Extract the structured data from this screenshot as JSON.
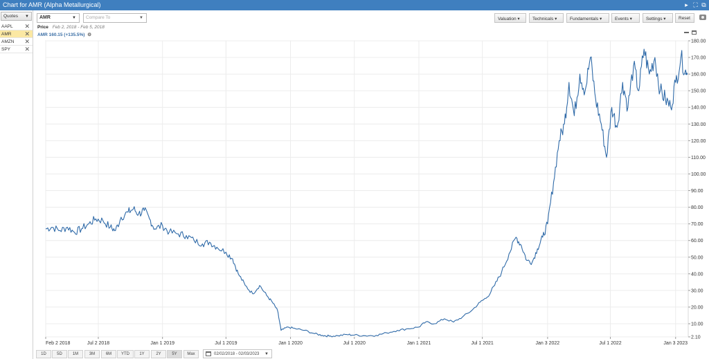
{
  "window": {
    "title": "Chart for AMR (Alpha Metallurgical)",
    "controls": [
      "play-icon",
      "expand-icon",
      "popout-icon"
    ]
  },
  "sidebar": {
    "dropdown_label": "Quotes",
    "quotes": [
      {
        "symbol": "AAPL",
        "selected": false
      },
      {
        "symbol": "AMR",
        "selected": true
      },
      {
        "symbol": "AMZN",
        "selected": false
      },
      {
        "symbol": "SPY",
        "selected": false
      }
    ]
  },
  "toolbar": {
    "symbol_value": "AMR",
    "compare_placeholder": "Compare To",
    "buttons": [
      "Valuation",
      "Technicals",
      "Fundamentals",
      "Events",
      "Settings"
    ],
    "reset_label": "Reset",
    "camera_icon": "camera-icon"
  },
  "header": {
    "price_label": "Price",
    "date_range_text": "Feb 2, 2018 - Feb 5, 2018",
    "series_label": "AMR 160.15 (+135.5%)"
  },
  "chart_data": {
    "type": "line",
    "title": "",
    "xlabel": "",
    "ylabel": "",
    "y_axis_side": "right",
    "ylim": [
      2.1,
      180.0
    ],
    "y_ticks": [
      "2.10",
      "10.00",
      "20.00",
      "30.00",
      "40.00",
      "50.00",
      "60.00",
      "70.00",
      "80.00",
      "90.00",
      "100.00",
      "110.00",
      "120.00",
      "130.00",
      "140.00",
      "150.00",
      "160.00",
      "170.00",
      "180.00"
    ],
    "x_ticks": [
      "Feb 2 2018",
      "Jul 2 2018",
      "Jan 1 2019",
      "Jul 1 2019",
      "Jan 1 2020",
      "Jul 1 2020",
      "Jan 1 2021",
      "Jul 1 2021",
      "Jan 3 2022",
      "Jul 1 2022",
      "Jan 3 2023"
    ],
    "grid": true,
    "line_color": "#2f6aa8",
    "series": [
      {
        "name": "AMR",
        "points": [
          [
            "2018-02-02",
            67
          ],
          [
            "2018-02-20",
            68
          ],
          [
            "2018-03-15",
            66
          ],
          [
            "2018-04-05",
            68
          ],
          [
            "2018-04-25",
            65
          ],
          [
            "2018-05-15",
            67
          ],
          [
            "2018-06-05",
            70
          ],
          [
            "2018-06-25",
            73
          ],
          [
            "2018-07-15",
            72
          ],
          [
            "2018-08-05",
            68
          ],
          [
            "2018-08-20",
            66
          ],
          [
            "2018-09-05",
            74
          ],
          [
            "2018-09-25",
            77
          ],
          [
            "2018-10-10",
            79
          ],
          [
            "2018-10-25",
            76
          ],
          [
            "2018-11-10",
            78
          ],
          [
            "2018-11-25",
            73
          ],
          [
            "2018-12-10",
            67
          ],
          [
            "2019-01-01",
            69
          ],
          [
            "2019-01-20",
            65
          ],
          [
            "2019-02-15",
            64
          ],
          [
            "2019-03-10",
            63
          ],
          [
            "2019-04-01",
            60
          ],
          [
            "2019-04-25",
            58
          ],
          [
            "2019-05-15",
            59
          ],
          [
            "2019-06-05",
            56
          ],
          [
            "2019-07-01",
            53
          ],
          [
            "2019-07-20",
            49
          ],
          [
            "2019-08-05",
            40
          ],
          [
            "2019-08-25",
            33
          ],
          [
            "2019-09-15",
            28
          ],
          [
            "2019-10-05",
            33
          ],
          [
            "2019-10-25",
            27
          ],
          [
            "2019-11-10",
            23
          ],
          [
            "2019-11-25",
            18
          ],
          [
            "2019-12-05",
            6
          ],
          [
            "2019-12-25",
            8
          ],
          [
            "2020-01-15",
            7
          ],
          [
            "2020-02-10",
            6
          ],
          [
            "2020-03-10",
            4
          ],
          [
            "2020-04-01",
            3
          ],
          [
            "2020-04-20",
            2.6
          ],
          [
            "2020-05-15",
            2.8
          ],
          [
            "2020-06-10",
            3.5
          ],
          [
            "2020-07-01",
            3.2
          ],
          [
            "2020-08-01",
            2.8
          ],
          [
            "2020-09-01",
            3.0
          ],
          [
            "2020-10-01",
            4.5
          ],
          [
            "2020-11-01",
            6
          ],
          [
            "2020-12-01",
            7
          ],
          [
            "2021-01-01",
            8
          ],
          [
            "2021-01-20",
            11
          ],
          [
            "2021-02-15",
            10
          ],
          [
            "2021-03-15",
            13
          ],
          [
            "2021-04-10",
            11
          ],
          [
            "2021-05-05",
            14
          ],
          [
            "2021-06-01",
            18
          ],
          [
            "2021-06-25",
            23
          ],
          [
            "2021-07-15",
            26
          ],
          [
            "2021-08-05",
            33
          ],
          [
            "2021-08-25",
            41
          ],
          [
            "2021-09-15",
            52
          ],
          [
            "2021-10-05",
            62
          ],
          [
            "2021-10-20",
            57
          ],
          [
            "2021-11-05",
            48
          ],
          [
            "2021-11-20",
            47
          ],
          [
            "2021-12-05",
            55
          ],
          [
            "2021-12-20",
            62
          ],
          [
            "2022-01-03",
            70
          ],
          [
            "2022-01-20",
            95
          ],
          [
            "2022-02-05",
            120
          ],
          [
            "2022-02-20",
            130
          ],
          [
            "2022-03-05",
            155
          ],
          [
            "2022-03-20",
            135
          ],
          [
            "2022-04-05",
            160
          ],
          [
            "2022-04-20",
            150
          ],
          [
            "2022-05-05",
            170
          ],
          [
            "2022-05-20",
            145
          ],
          [
            "2022-06-05",
            130
          ],
          [
            "2022-06-20",
            110
          ],
          [
            "2022-07-05",
            140
          ],
          [
            "2022-07-20",
            128
          ],
          [
            "2022-08-05",
            155
          ],
          [
            "2022-08-20",
            140
          ],
          [
            "2022-09-05",
            165
          ],
          [
            "2022-09-20",
            150
          ],
          [
            "2022-10-05",
            175
          ],
          [
            "2022-10-20",
            160
          ],
          [
            "2022-11-05",
            170
          ],
          [
            "2022-11-20",
            150
          ],
          [
            "2022-12-05",
            145
          ],
          [
            "2022-12-20",
            140
          ],
          [
            "2023-01-03",
            155
          ],
          [
            "2023-01-18",
            170
          ],
          [
            "2023-02-03",
            160.15
          ]
        ]
      }
    ]
  },
  "bottombar": {
    "ranges": [
      "1D",
      "5D",
      "1M",
      "3M",
      "6M",
      "YTD",
      "1Y",
      "2Y",
      "5Y",
      "Max"
    ],
    "active_range": "5Y",
    "date_range": "02/02/2018 - 02/03/2023"
  }
}
